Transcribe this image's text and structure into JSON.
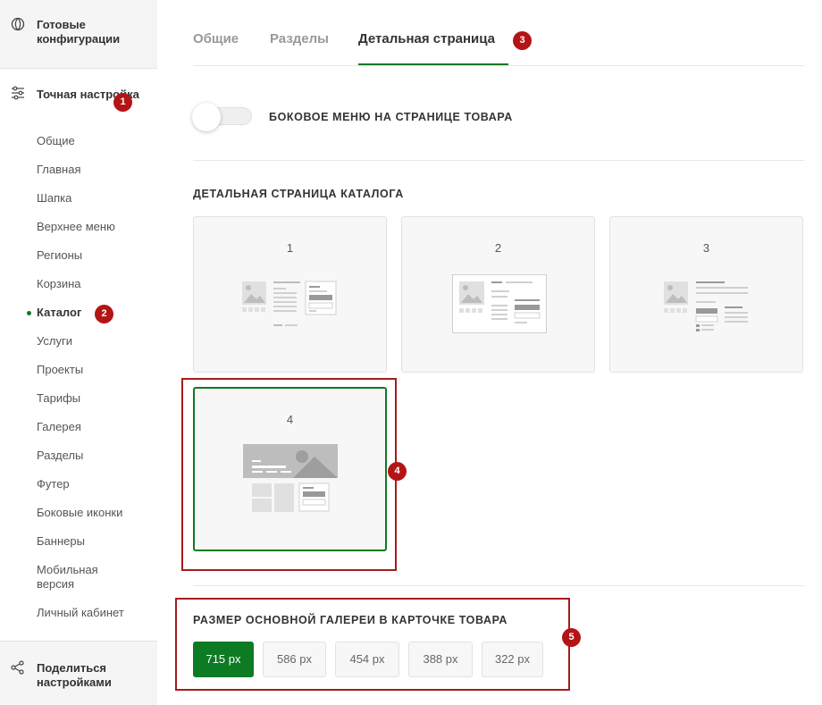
{
  "sidebar": {
    "top_block": {
      "label": "Готовые конфигурации",
      "icon": "configurations-icon"
    },
    "section": {
      "label": "Точная настройка",
      "icon": "sliders-icon",
      "badge": "1"
    },
    "items": [
      {
        "label": "Общие"
      },
      {
        "label": "Главная"
      },
      {
        "label": "Шапка"
      },
      {
        "label": "Верхнее меню"
      },
      {
        "label": "Регионы"
      },
      {
        "label": "Корзина"
      },
      {
        "label": "Каталог",
        "active": true,
        "badge": "2"
      },
      {
        "label": "Услуги"
      },
      {
        "label": "Проекты"
      },
      {
        "label": "Тарифы"
      },
      {
        "label": "Галерея"
      },
      {
        "label": "Разделы"
      },
      {
        "label": "Футер"
      },
      {
        "label": "Боковые иконки"
      },
      {
        "label": "Баннеры"
      },
      {
        "label": "Мобильная версия"
      },
      {
        "label": "Личный кабинет"
      }
    ],
    "bottom_block": {
      "label": "Поделиться настройками",
      "icon": "share-icon"
    }
  },
  "tabs": [
    {
      "label": "Общие"
    },
    {
      "label": "Разделы"
    },
    {
      "label": "Детальная страница",
      "active": true,
      "badge": "3"
    }
  ],
  "side_menu_toggle": {
    "label": "БОКОВОЕ МЕНЮ НА СТРАНИЦЕ ТОВАРА",
    "enabled": false
  },
  "detail_page": {
    "title": "ДЕТАЛЬНАЯ СТРАНИЦА КАТАЛОГА",
    "options": [
      {
        "label": "1"
      },
      {
        "label": "2"
      },
      {
        "label": "3"
      },
      {
        "label": "4",
        "selected": true
      }
    ],
    "badge": "4"
  },
  "gallery_size": {
    "title": "РАЗМЕР ОСНОВНОЙ ГАЛЕРЕИ В КАРТОЧКЕ ТОВАРА",
    "options": [
      {
        "label": "715 px",
        "selected": true
      },
      {
        "label": "586 px"
      },
      {
        "label": "454 px"
      },
      {
        "label": "388 px"
      },
      {
        "label": "322 px"
      }
    ],
    "badge": "5"
  },
  "colors": {
    "accent": "#0d7a24",
    "badge": "#b31416",
    "frame": "#a51c1e"
  }
}
